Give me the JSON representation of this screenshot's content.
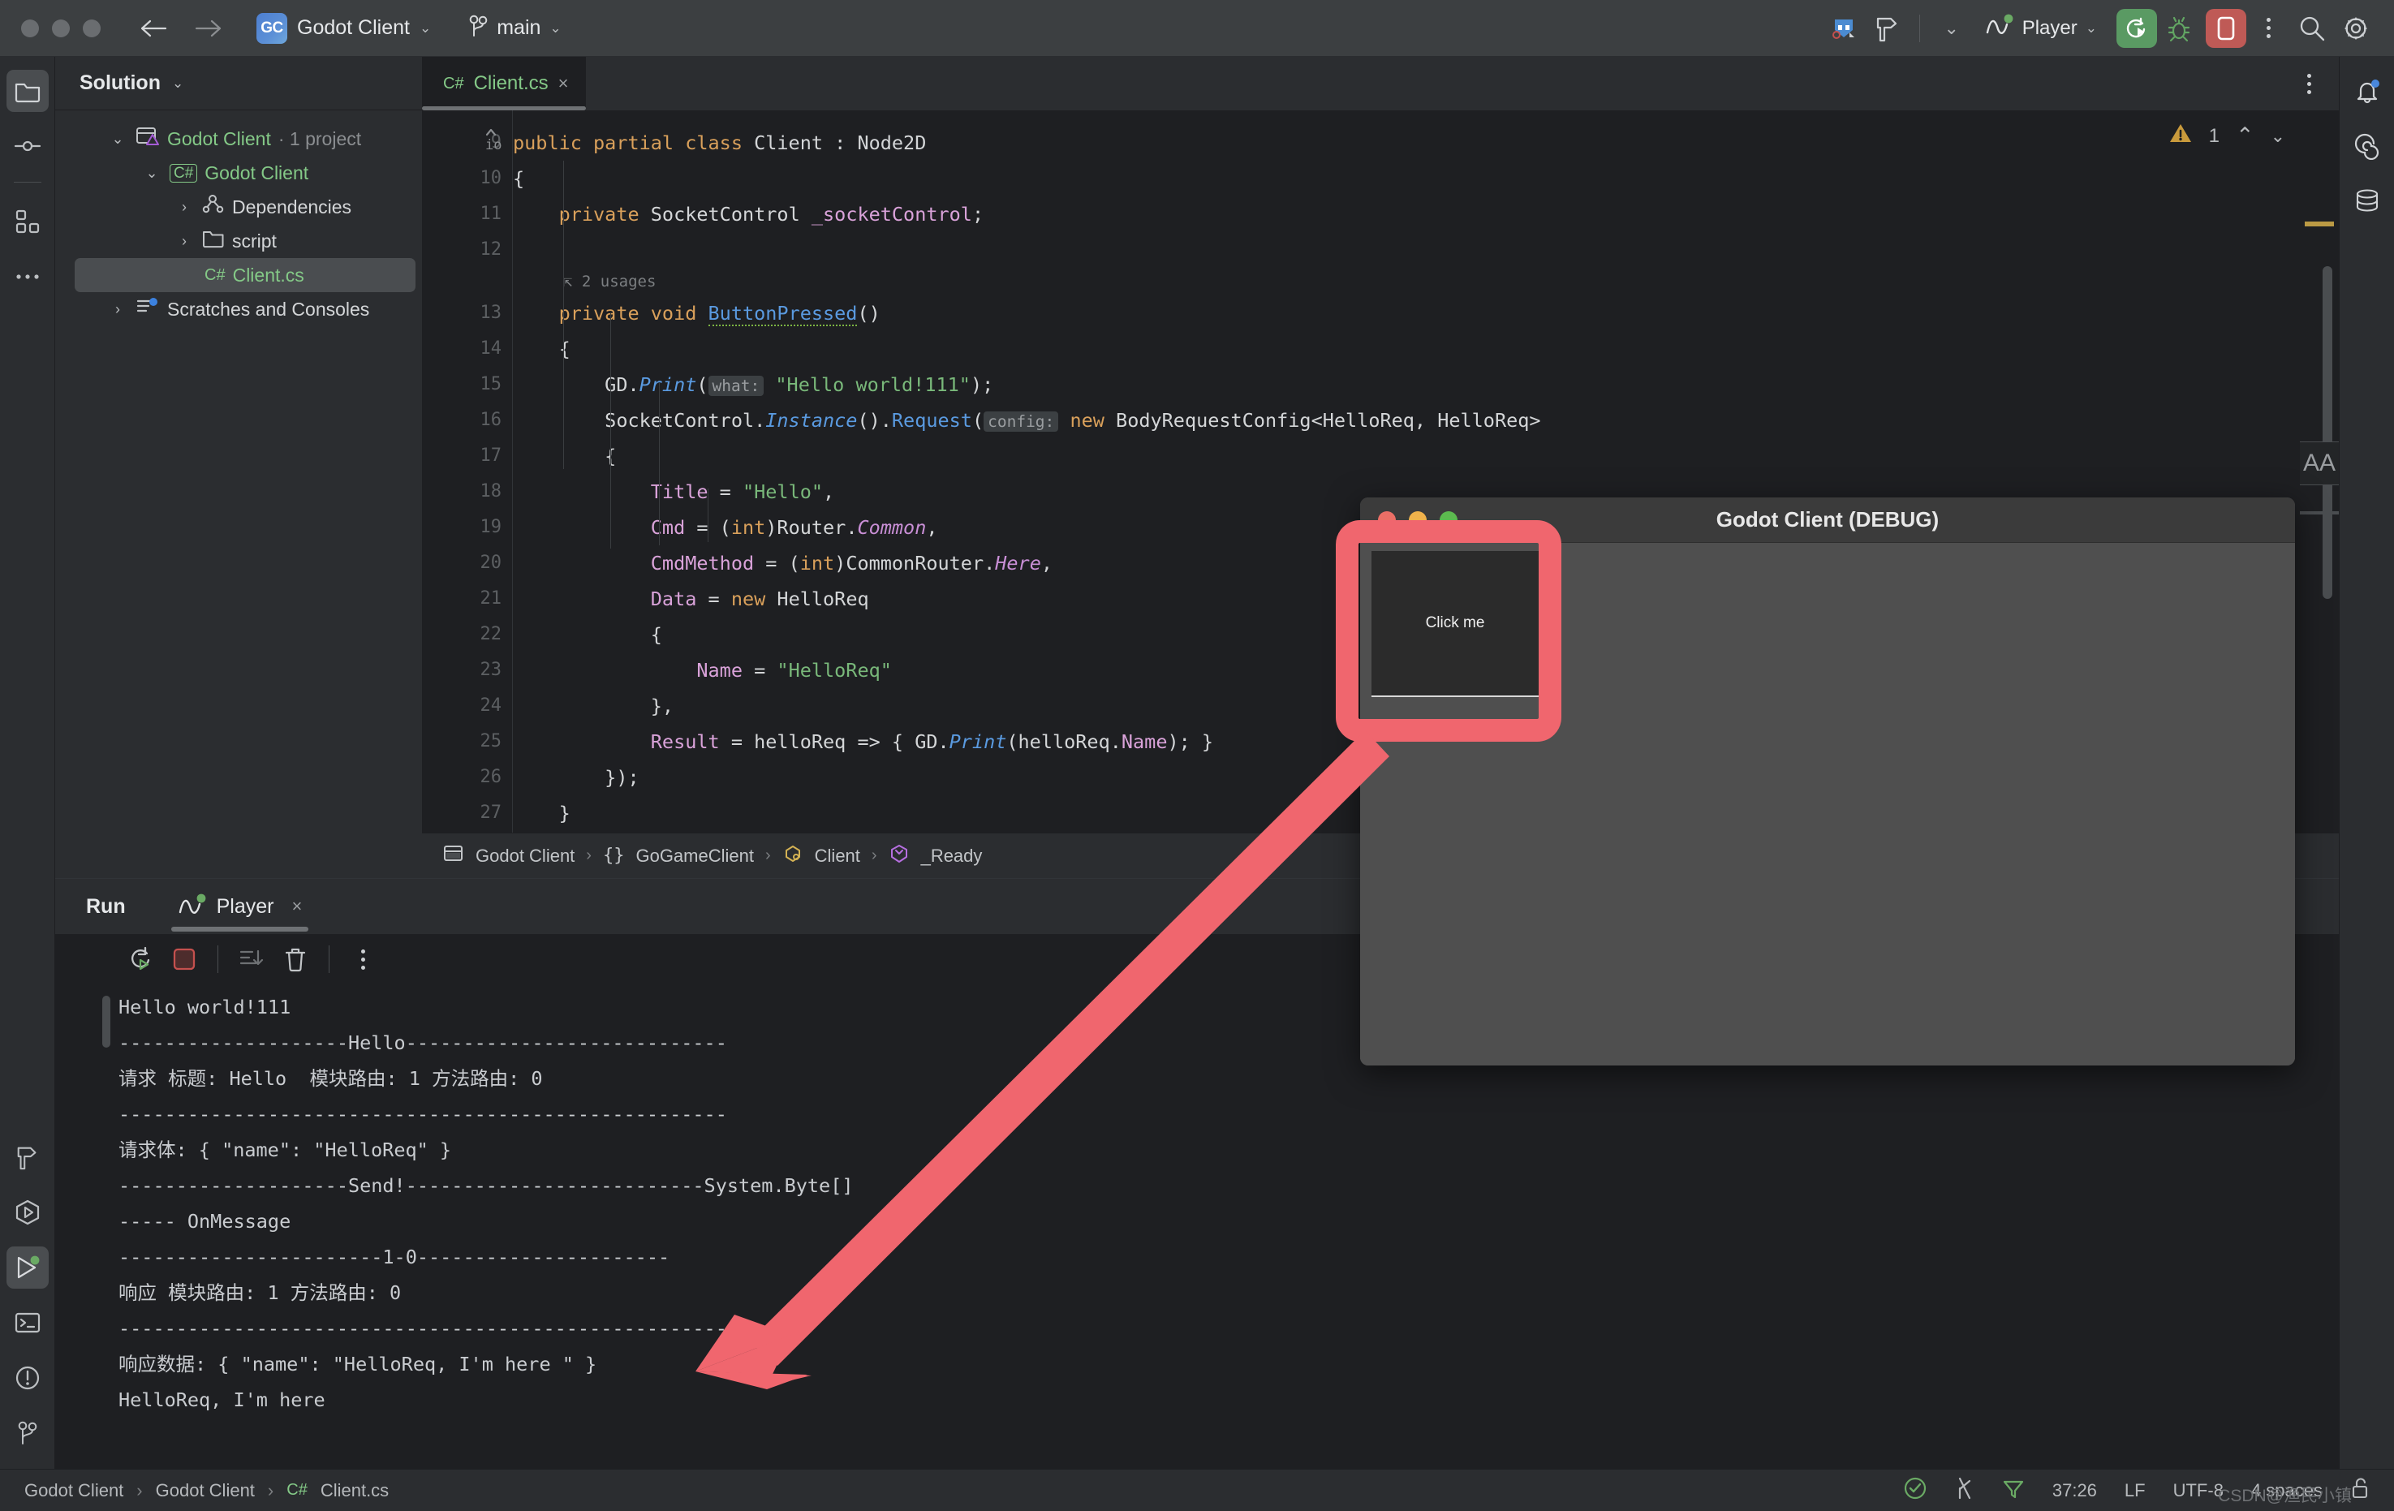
{
  "titlebar": {
    "project_name": "Godot Client",
    "project_initials": "GC",
    "branch": "main",
    "run_config": "Player",
    "icons": {
      "back": "back-arrow-icon",
      "forward": "forward-arrow-icon",
      "godot": "godot-engine-icon",
      "build": "hammer-build-icon",
      "more_toolbar": "chevron-down-icon",
      "run": "run-icon",
      "debug": "debug-bug-icon",
      "stop": "stop-icon",
      "overflow": "kebab-menu-icon",
      "search": "search-icon",
      "settings": "gear-icon"
    }
  },
  "left_rail": {
    "items": [
      {
        "name": "project-tool",
        "icon": "folder-icon",
        "active": true
      },
      {
        "name": "commit-tool",
        "icon": "commit-icon",
        "active": false
      },
      {
        "name": "structure-tool",
        "icon": "structure-icon",
        "active": false
      },
      {
        "name": "more-tools",
        "icon": "ellipsis-icon",
        "active": false
      },
      {
        "name": "build-tool",
        "icon": "hammer-icon",
        "active": false
      },
      {
        "name": "unit-tests-tool",
        "icon": "play-hexagon-icon",
        "active": false
      },
      {
        "name": "run-tool",
        "icon": "play-icon",
        "active": true
      },
      {
        "name": "terminal-tool",
        "icon": "terminal-icon",
        "active": false
      },
      {
        "name": "problems-tool",
        "icon": "warning-circle-icon",
        "active": false
      },
      {
        "name": "version-control-tool",
        "icon": "branch-icon",
        "active": false
      }
    ]
  },
  "right_rail": {
    "items": [
      {
        "name": "notifications",
        "icon": "bell-icon",
        "badge": true
      },
      {
        "name": "ai-assistant",
        "icon": "spiral-icon",
        "badge": false
      },
      {
        "name": "database",
        "icon": "database-icon",
        "badge": false
      }
    ]
  },
  "solution": {
    "header": "Solution",
    "tree": [
      {
        "label": "Godot Client",
        "suffix": " · 1 project",
        "depth": 0,
        "twist": "down",
        "icon": "solution-icon",
        "color": "green",
        "selected": false
      },
      {
        "label": "Godot Client",
        "depth": 1,
        "twist": "down",
        "icon": "csharp-project-icon",
        "color": "green",
        "selected": false
      },
      {
        "label": "Dependencies",
        "depth": 2,
        "twist": "right",
        "icon": "dependencies-icon",
        "color": "plain",
        "selected": false
      },
      {
        "label": "script",
        "depth": 2,
        "twist": "right",
        "icon": "folder-icon",
        "color": "plain",
        "selected": false
      },
      {
        "label": "Client.cs",
        "depth": 3,
        "twist": "none",
        "icon": "csharp-file-icon",
        "color": "green",
        "selected": true
      },
      {
        "label": "Scratches and Consoles",
        "depth": 0,
        "twist": "right",
        "icon": "scratches-icon",
        "color": "plain",
        "selected": false
      }
    ]
  },
  "editor": {
    "tab": {
      "icon_label": "C#",
      "filename": "Client.cs",
      "close": "×"
    },
    "warnings": {
      "count": "1",
      "icon": "warning-triangle-icon",
      "prev": "chevron-up-icon",
      "next": "chevron-down-icon"
    },
    "line_numbers": [
      "9",
      "10",
      "11",
      "12",
      "",
      "13",
      "14",
      "15",
      "16",
      "17",
      "18",
      "19",
      "20",
      "21",
      "22",
      "23",
      "24",
      "25",
      "26",
      "27"
    ],
    "usages_hint": "2 usages",
    "code_lines": [
      "public partial class Client : Node2D",
      "{",
      "    private SocketControl _socketControl;",
      "",
      "    private void ButtonPressed()",
      "    {",
      "        GD.Print(what: \"Hello world!111\");",
      "        SocketControl.Instance().Request(config: new BodyRequestConfig<HelloReq, HelloReq>",
      "        {",
      "            Title = \"Hello\",",
      "            Cmd = (int)Router.Common,",
      "            CmdMethod = (int)CommonRouter.Here,",
      "            Data = new HelloReq",
      "            {",
      "                Name = \"HelloReq\"",
      "            },",
      "            Result = helloReq => { GD.Print(helloReq.Name); }",
      "        });",
      "    }"
    ],
    "font_size_widget": "AA",
    "breadcrumb": [
      {
        "label": "Godot Client",
        "icon": "module-icon"
      },
      {
        "label": "GoGameClient",
        "icon": "namespace-icon"
      },
      {
        "label": "Client",
        "icon": "class-icon"
      },
      {
        "label": "_Ready",
        "icon": "method-icon"
      }
    ]
  },
  "run_panel": {
    "title": "Run",
    "tab_label": "Player",
    "tab_icon": "godot-player-icon",
    "tab_close": "×",
    "toolbar": [
      {
        "name": "rerun-button",
        "icon": "rerun-icon"
      },
      {
        "name": "stop-button",
        "icon": "stop-square-icon"
      },
      {
        "name": "scroll-to-end-button",
        "icon": "scroll-end-icon"
      },
      {
        "name": "clear-all-button",
        "icon": "trash-icon"
      },
      {
        "name": "more-options-button",
        "icon": "kebab-menu-icon"
      }
    ],
    "console_lines": [
      "Hello world!111",
      "--------------------Hello----------------------------",
      "请求 标题: Hello  模块路由: 1 方法路由: 0",
      "-----------------------------------------------------",
      "请求体: { \"name\": \"HelloReq\" }",
      "--------------------Send!--------------------------System.Byte[]",
      "----- OnMessage",
      "-----------------------1-0----------------------",
      "响应 模块路由: 1 方法路由: 0",
      "-----------------------------------------------------",
      "响应数据: { \"name\": \"HelloReq, I'm here \" }",
      "HelloReq, I'm here"
    ]
  },
  "statusbar": {
    "breadcrumb": [
      "Godot Client",
      "Godot Client",
      "Client.cs"
    ],
    "file_icon_label": "C#",
    "separator": "›",
    "inspection_icon": "inspections-ok-icon",
    "branch_icon": "branch-icon",
    "filter_icon": "filter-icon",
    "caret_position": "37:26",
    "line_separator": "LF",
    "encoding": "UTF-8",
    "indent": "4 spaces",
    "lock_icon": "unlocked-icon",
    "watermark": "CSDN@渔民小镇"
  },
  "godot_window": {
    "title": "Godot Client (DEBUG)",
    "button_label": "Click me",
    "traffic_colors": {
      "close": "#eb6f66",
      "minimize": "#f0b24b",
      "zoom": "#5cba4f"
    }
  },
  "annotation": {
    "highlight_color": "#f0666e",
    "arrow_color": "#f0666e"
  }
}
